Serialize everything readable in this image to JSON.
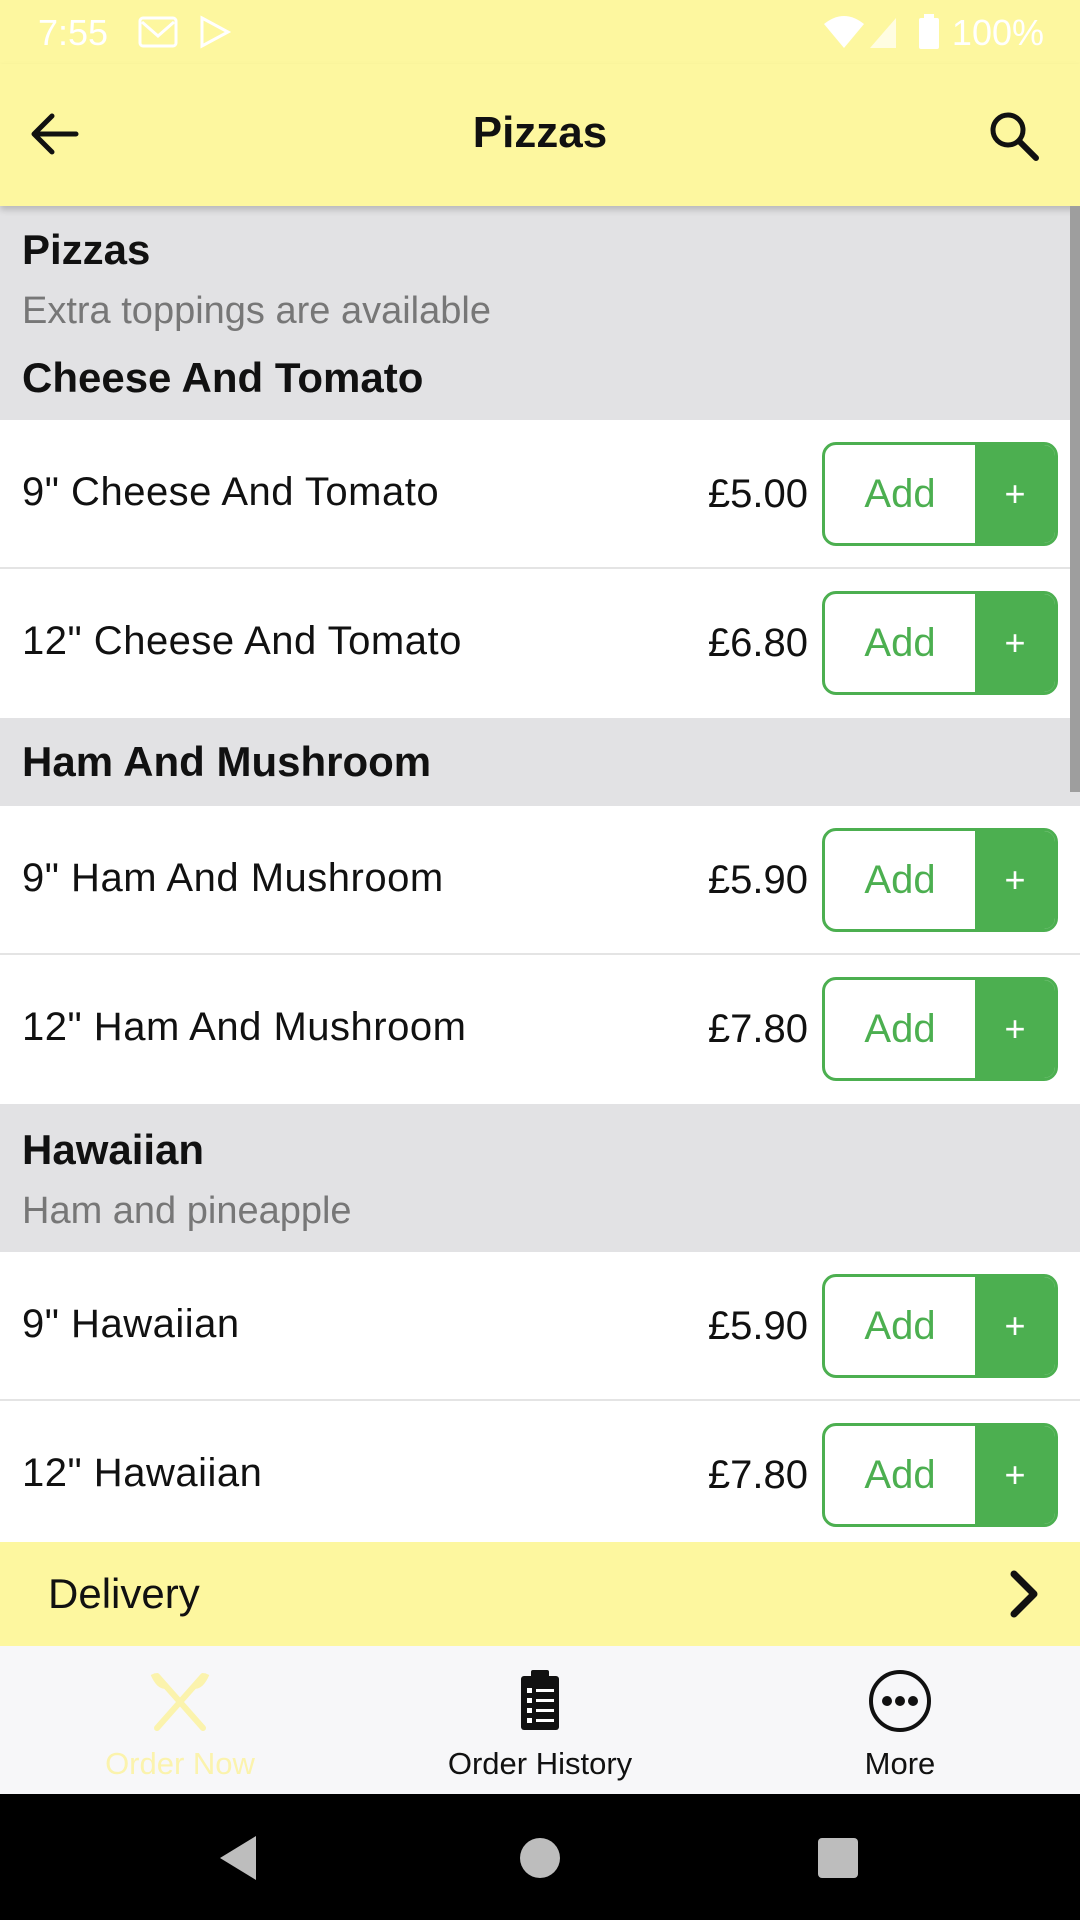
{
  "status_bar": {
    "time": "7:55",
    "battery": "100%",
    "icons": [
      "gmail-icon",
      "play-store-icon",
      "wifi-icon",
      "signal-icon",
      "battery-icon"
    ]
  },
  "app_bar": {
    "title": "Pizzas",
    "back_icon": "arrow-left-icon",
    "search_icon": "search-icon"
  },
  "category": {
    "title": "Pizzas",
    "subtitle": "Extra toppings are available"
  },
  "groups": [
    {
      "title": "Cheese And Tomato",
      "subtitle": "",
      "items": [
        {
          "name": "9\" Cheese And Tomato",
          "price": "£5.00",
          "add_label": "Add",
          "plus_label": "+"
        },
        {
          "name": "12\" Cheese And Tomato",
          "price": "£6.80",
          "add_label": "Add",
          "plus_label": "+"
        }
      ]
    },
    {
      "title": "Ham And Mushroom",
      "subtitle": "",
      "items": [
        {
          "name": "9\" Ham And Mushroom",
          "price": "£5.90",
          "add_label": "Add",
          "plus_label": "+"
        },
        {
          "name": "12\" Ham And Mushroom",
          "price": "£7.80",
          "add_label": "Add",
          "plus_label": "+"
        }
      ]
    },
    {
      "title": "Hawaiian",
      "subtitle": "Ham and pineapple",
      "items": [
        {
          "name": "9\" Hawaiian",
          "price": "£5.90",
          "add_label": "Add",
          "plus_label": "+"
        },
        {
          "name": "12\" Hawaiian",
          "price": "£7.80",
          "add_label": "Add",
          "plus_label": "+"
        }
      ]
    }
  ],
  "delivery_bar": {
    "label": "Delivery",
    "icon": "chevron-right-icon"
  },
  "bottom_nav": {
    "items": [
      {
        "label": "Order Now",
        "icon": "fork-knife-icon",
        "active": true
      },
      {
        "label": "Order History",
        "icon": "clipboard-list-icon",
        "active": false
      },
      {
        "label": "More",
        "icon": "more-circle-icon",
        "active": false
      }
    ]
  },
  "colors": {
    "header_bg": "#fdf79f",
    "accent_green": "#4caf50",
    "section_bg": "#e2e2e4",
    "active_nav": "#fbf3ad"
  }
}
